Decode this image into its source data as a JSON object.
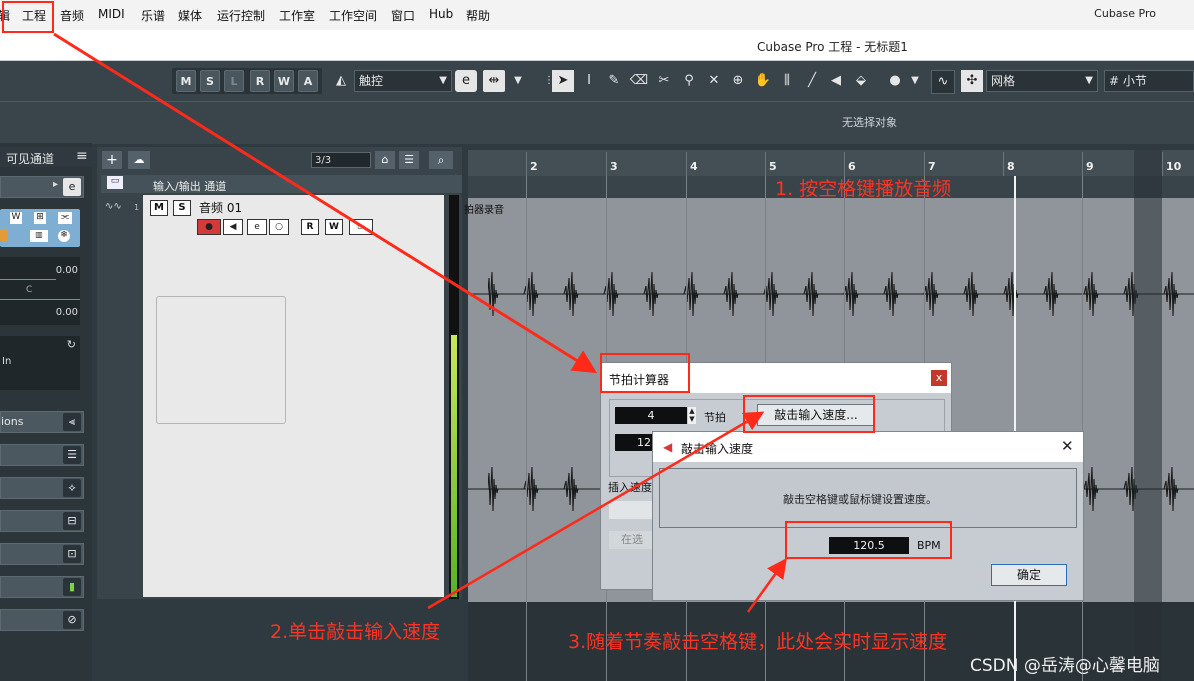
{
  "menu": {
    "items": [
      "编辑",
      "工程",
      "音频",
      "MIDI",
      "乐谱",
      "媒体",
      "运行控制",
      "工作室",
      "工作空间",
      "窗口",
      "Hub",
      "帮助"
    ],
    "app_name": "Cubase Pro"
  },
  "window_title": "Cubase Pro 工程 - 无标题1",
  "toolbar": {
    "modes": [
      "M",
      "S",
      "L",
      "R",
      "W",
      "A"
    ],
    "automation_mode": "触控",
    "snap_type": "网格",
    "grid_value": "小节"
  },
  "info_line": "无选择对象",
  "inspector": {
    "header": "可见通道",
    "value_1": "0.00",
    "pan_label": "C",
    "value_2": "0.00",
    "input_label": "In",
    "section_label": "ions"
  },
  "tracklist": {
    "counter": "3/3",
    "io_label": "输入/输出 通道",
    "track_number": "1",
    "track_name": "音频 01",
    "mute": "M",
    "solo": "S",
    "read": "R",
    "write": "W"
  },
  "ruler": {
    "bars": [
      "2",
      "3",
      "4",
      "5",
      "6",
      "7",
      "8",
      "9",
      "10"
    ]
  },
  "event_label": "拍器录音",
  "tap_calculator": {
    "title": "节拍计算器",
    "beats_value": "4",
    "beats_label": "节拍",
    "tap_button": "敲击输入速度...",
    "tempo_partial": "12",
    "insert_label": "插入速度",
    "partial_button": "在选"
  },
  "tap_dialog": {
    "title": "敲击输入速度",
    "instruction": "敲击空格键或鼠标键设置速度。",
    "bpm_value": "120.5",
    "bpm_unit": "BPM",
    "ok_button": "确定"
  },
  "annotations": {
    "step1": "1. 按空格键播放音频",
    "step2": "2.单击敲击输入速度",
    "step3": "3.随着节奏敲击空格键，此处会实时显示速度"
  },
  "watermark": "CSDN @岳涛@心馨电脑",
  "colors": {
    "annotation_red": "#ff2a1a",
    "record_red": "#d43a3a",
    "meter_green": "#5ab02a"
  }
}
